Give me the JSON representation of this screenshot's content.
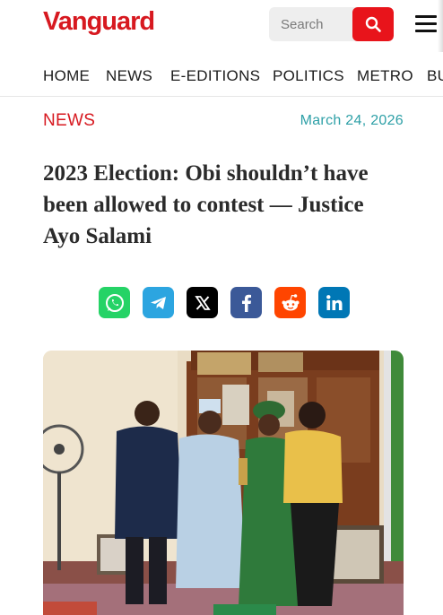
{
  "header": {
    "logo_text": "Vanguard",
    "search_placeholder": "Search",
    "search_icon": "search-icon",
    "menu_icon": "hamburger-menu-icon"
  },
  "nav": {
    "items": [
      "HOME",
      "NEWS",
      "E-EDITIONS",
      "POLITICS",
      "METRO",
      "BU"
    ]
  },
  "article": {
    "section": "NEWS",
    "date": "March 24, 2026",
    "headline_lines": [
      "2023 Election: Obi shouldn’t have",
      "been allowed to contest — Justice",
      "Ayo Salami"
    ]
  },
  "share": [
    {
      "name": "whatsapp",
      "icon": "whatsapp-icon",
      "color": "#25d366"
    },
    {
      "name": "telegram",
      "icon": "telegram-icon",
      "color": "#2ca5e0"
    },
    {
      "name": "x",
      "icon": "x-icon",
      "color": "#000000"
    },
    {
      "name": "facebook",
      "icon": "facebook-icon",
      "color": "#3b5998"
    },
    {
      "name": "reddit",
      "icon": "reddit-icon",
      "color": "#ff4500"
    },
    {
      "name": "linkedin",
      "icon": "linkedin-icon",
      "color": "#0077b5"
    }
  ],
  "colors": {
    "brand_red": "#d71920",
    "date_teal": "#2ea0a7"
  }
}
